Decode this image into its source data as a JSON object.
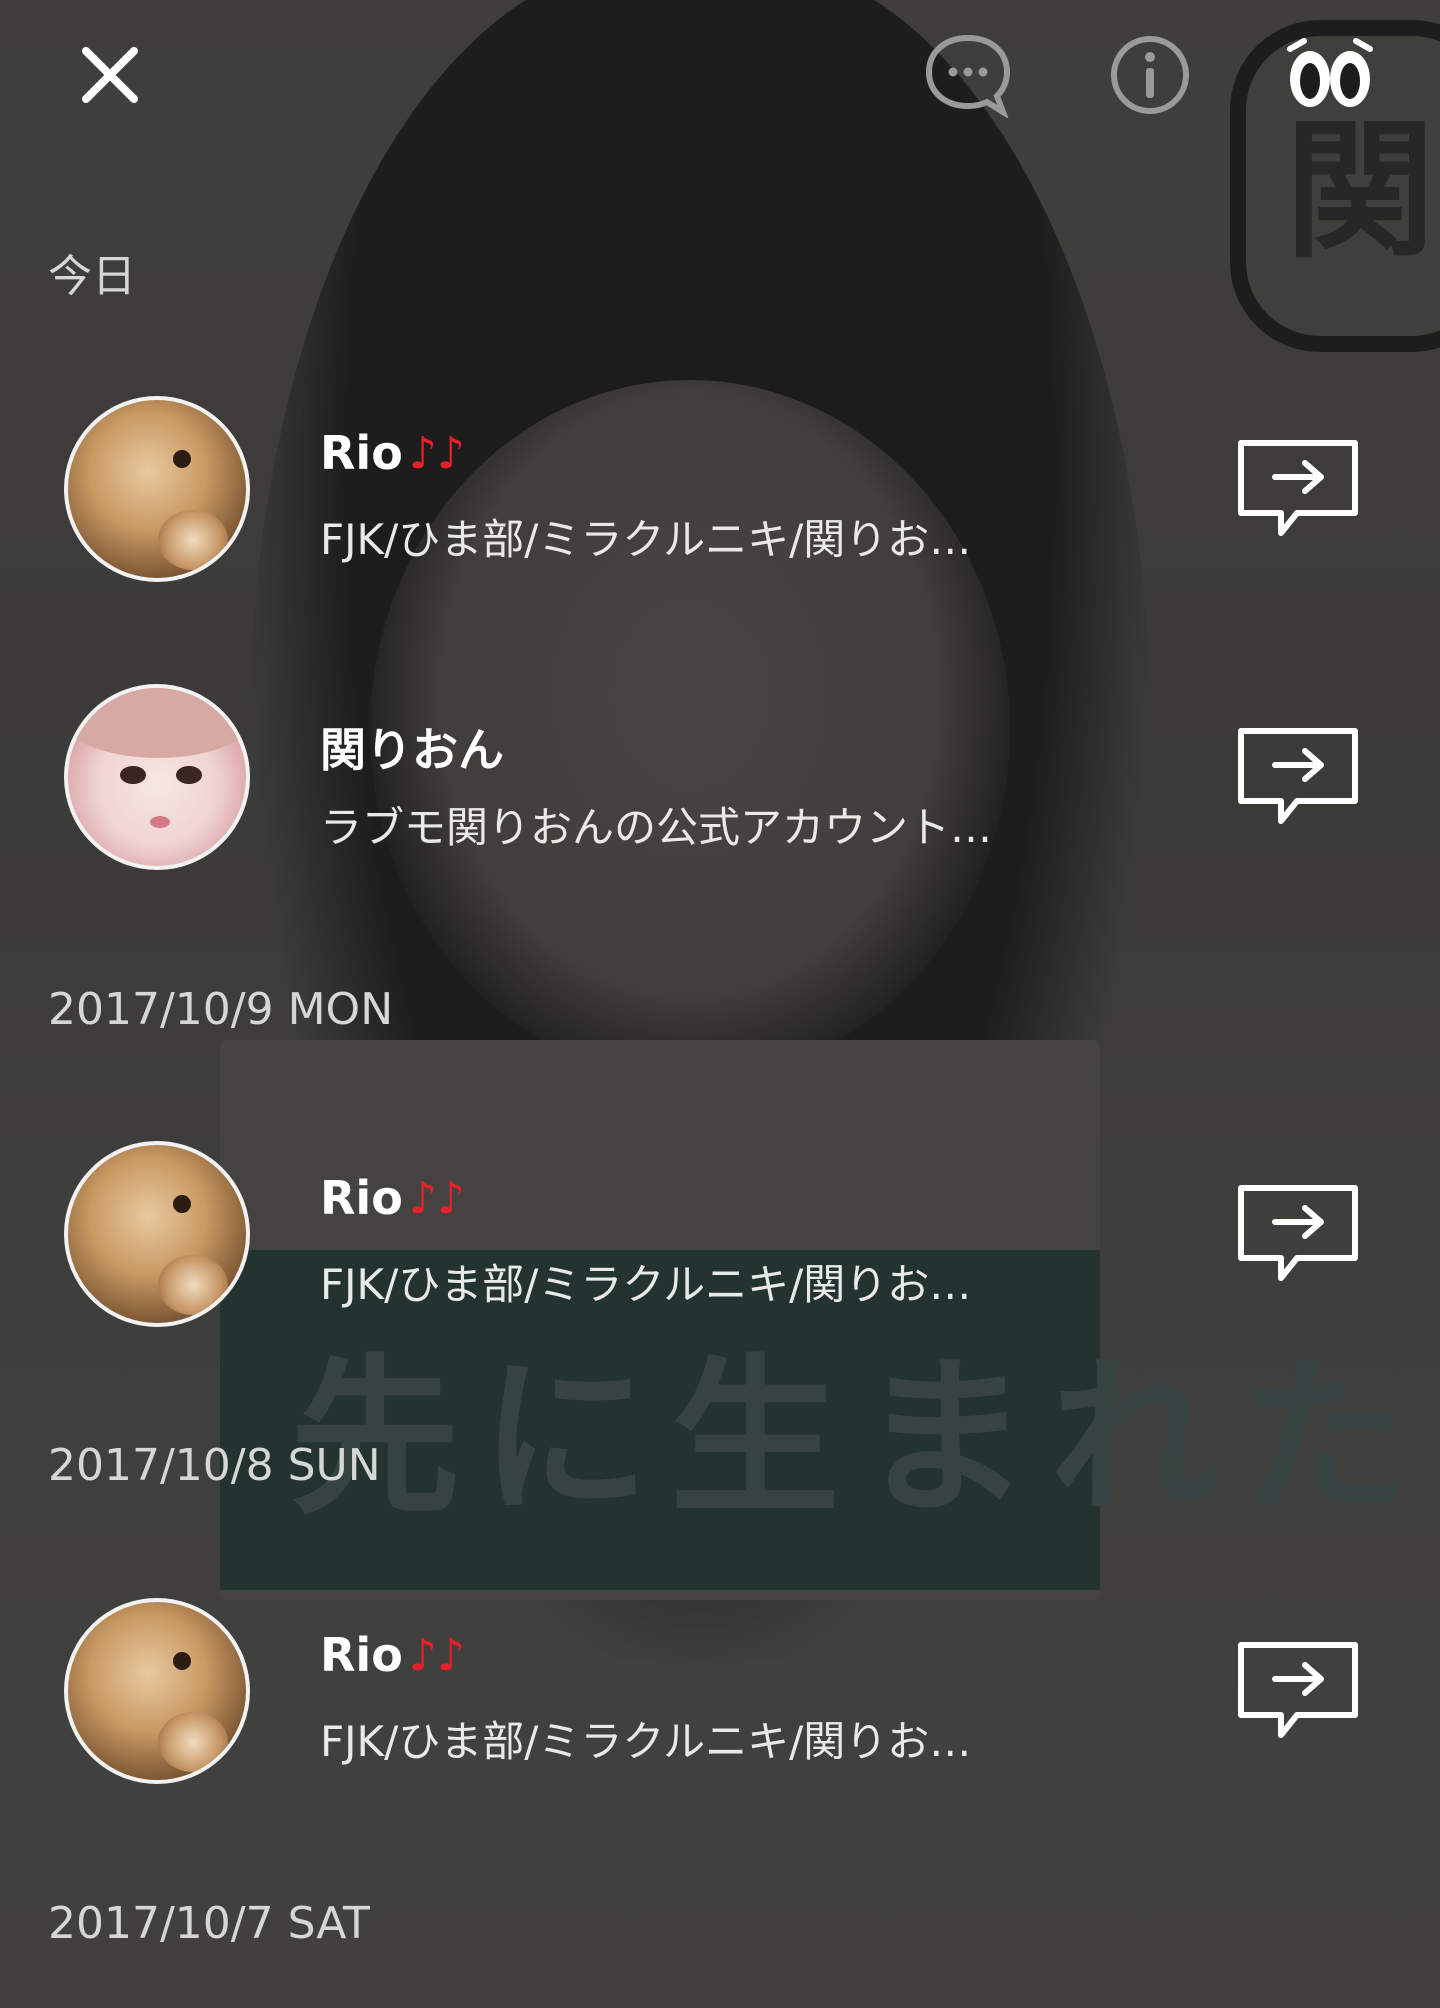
{
  "header": {
    "close_icon": "close-icon",
    "chat_icon": "chat-bubble-icon",
    "info_icon": "info-icon",
    "eyes_icon": "eyes-icon"
  },
  "sections": [
    {
      "label": "今日",
      "items": [
        {
          "name": "Rio",
          "name_suffix": "♪♪",
          "desc": "FJK/ひま部/ミラクルニキ/関りお…",
          "avatar": "dog"
        },
        {
          "name": "関りおん",
          "name_suffix": "",
          "desc": "ラブモ関りおんの公式アカウント…",
          "avatar": "girl"
        }
      ]
    },
    {
      "label": "2017/10/9 MON",
      "items": [
        {
          "name": "Rio",
          "name_suffix": "♪♪",
          "desc": "FJK/ひま部/ミラクルニキ/関りお…",
          "avatar": "dog"
        }
      ]
    },
    {
      "label": "2017/10/8 SUN",
      "items": [
        {
          "name": "Rio",
          "name_suffix": "♪♪",
          "desc": "FJK/ひま部/ミラクルニキ/関りお…",
          "avatar": "dog"
        }
      ]
    },
    {
      "label": "2017/10/7 SAT",
      "items": []
    }
  ],
  "background_text": {
    "card": "先に生まれただけの僕",
    "logo": "関"
  },
  "colors": {
    "note_red": "#e8202a",
    "text_white": "#ffffff",
    "label_gray": "#d6d6d6"
  }
}
